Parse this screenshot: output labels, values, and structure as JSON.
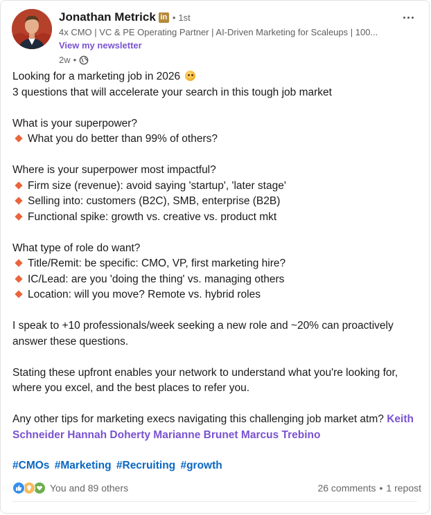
{
  "author": {
    "name": "Jonathan Metrick",
    "degree": "1st",
    "degree_separator": "•",
    "headline": "4x CMO | VC & PE Operating Partner | AI-Driven Marketing for Scaleups | 100...",
    "newsletter_link": "View my newsletter",
    "post_age": "2w",
    "meta_separator": "•"
  },
  "post": {
    "intro_line_1": "Looking for a marketing job in 2026",
    "intro_line_2": "3 questions that will accelerate your search in this tough job market",
    "q1_heading": "What is your superpower?",
    "q1_bullets": [
      "What you do better than 99% of others?"
    ],
    "q2_heading": "Where is your superpower most impactful?",
    "q2_bullets": [
      "Firm size (revenue): avoid saying 'startup', 'later stage'",
      "Selling into: customers (B2C), SMB, enterprise (B2B)",
      "Functional spike: growth vs. creative vs. product mkt"
    ],
    "q3_heading": "What type of role do want?",
    "q3_bullets": [
      "Title/Remit: be specific: CMO, VP, first marketing hire?",
      "IC/Lead: are you 'doing the thing' vs. managing others",
      "Location: will you move? Remote vs. hybrid roles"
    ],
    "para1_line1": "I speak to +10 professionals/week seeking a new role and ~20% can proactively",
    "para1_line2": "answer these questions.",
    "para2_line1": "Stating these upfront enables your network to understand what you're looking for,",
    "para2_line2": "where you excel, and the best places to refer you.",
    "para3_text": "Any other tips for marketing execs navigating this challenging job market atm?",
    "mentions": [
      "Keith",
      "Schneider",
      "Hannah Doherty",
      "Marianne Brunet",
      "Marcus Trebino"
    ],
    "hashtags": [
      "#CMOs",
      "#Marketing",
      "#Recruiting",
      "#growth"
    ]
  },
  "social": {
    "reactions_text": "You and 89 others",
    "comments": "26 comments",
    "separator": "•",
    "reposts": "1 repost"
  },
  "icons": {
    "more": "more-options-icon",
    "linkedin_badge": "linkedin-premium-icon",
    "visibility": "globe-icon",
    "emoji": "flushed-face-emoji",
    "bullet": "orange-diamond-icon",
    "reactions": [
      "like-icon",
      "insightful-icon",
      "support-icon"
    ]
  },
  "colors": {
    "mention": "#7a52d1",
    "hashtag": "#0a66c2",
    "bullet": "#e9653b",
    "badge": "#b58a3a"
  }
}
